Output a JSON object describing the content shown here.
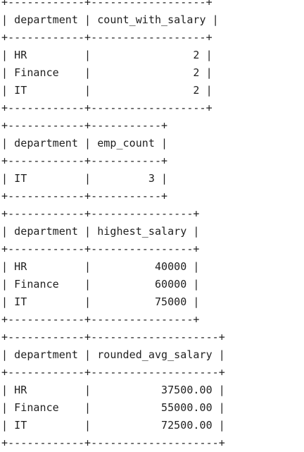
{
  "output_lines": [
    "+------------+------------------+",
    "| department | count_with_salary |",
    "+------------+------------------+",
    "| HR         |                2 |",
    "| Finance    |                2 |",
    "| IT         |                2 |",
    "+------------+------------------+",
    "+------------+-----------+",
    "| department | emp_count |",
    "+------------+-----------+",
    "| IT         |         3 |",
    "+------------+-----------+",
    "+------------+----------------+",
    "| department | highest_salary |",
    "+------------+----------------+",
    "| HR         |          40000 |",
    "| Finance    |          60000 |",
    "| IT         |          75000 |",
    "+------------+----------------+",
    "+------------+--------------------+",
    "| department | rounded_avg_salary |",
    "+------------+--------------------+",
    "| HR         |           37500.00 |",
    "| Finance    |           55000.00 |",
    "| IT         |           72500.00 |",
    "+------------+--------------------+"
  ]
}
